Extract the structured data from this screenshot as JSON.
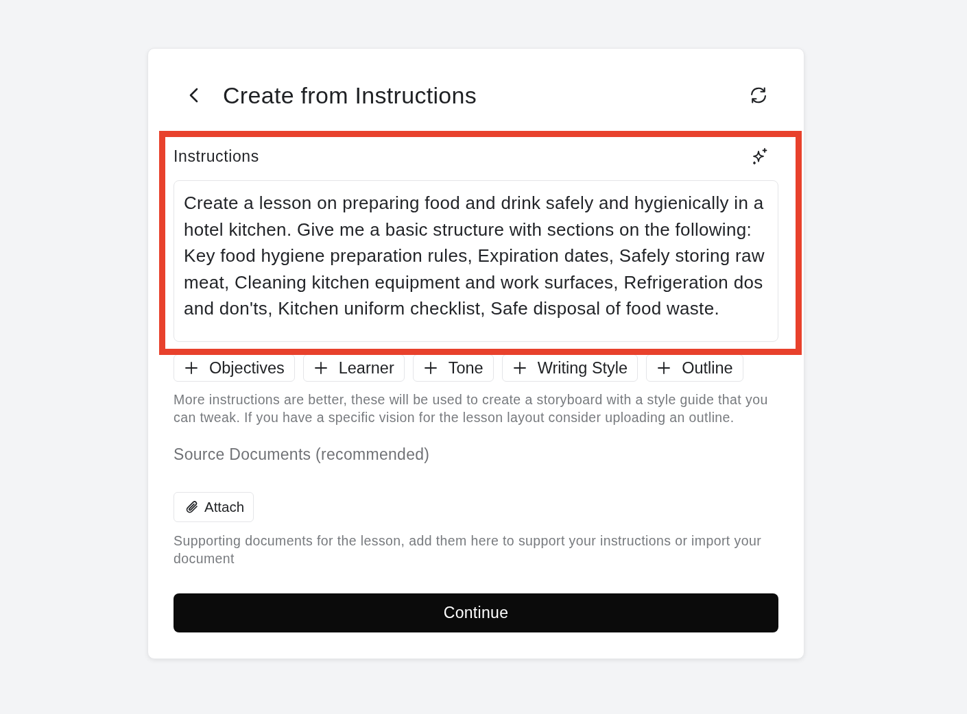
{
  "header": {
    "title": "Create from Instructions"
  },
  "instructions": {
    "label": "Instructions",
    "highlighted": true,
    "value": "Create a lesson on preparing food and drink safely and hygienically in a hotel kitchen. Give me a basic structure with sections on the following: Key food hygiene preparation rules, Expiration dates, Safely storing raw meat, Cleaning kitchen equipment and work surfaces, Refrigeration dos and don'ts, Kitchen uniform checklist, Safe disposal of food waste."
  },
  "add_options": [
    {
      "label": "Objectives"
    },
    {
      "label": "Learner"
    },
    {
      "label": "Tone"
    },
    {
      "label": "Writing Style"
    },
    {
      "label": "Outline"
    }
  ],
  "instructions_hint": "More instructions are better, these will be used to create a storyboard with a style guide that you can tweak. If you have a specific vision for the lesson layout consider uploading an outline.",
  "source_documents": {
    "title": "Source Documents (recommended)",
    "attach_button": "Attach",
    "hint": "Supporting documents for the lesson, add them here to support your instructions or import your document"
  },
  "continue_button": "Continue"
}
